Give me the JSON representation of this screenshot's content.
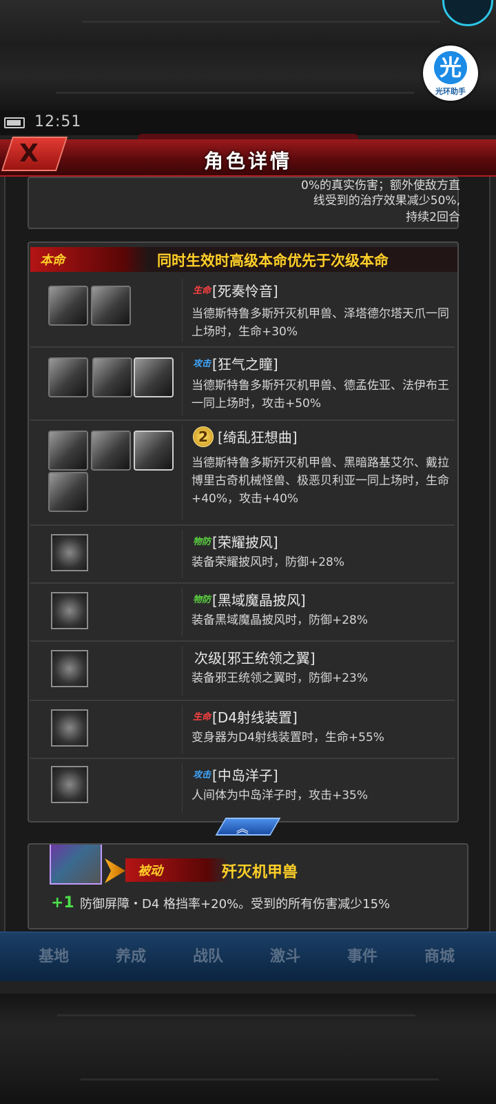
{
  "status": {
    "time": "12:51"
  },
  "helper": {
    "glyph": "光",
    "label": "光环助手"
  },
  "title": "角色详情",
  "close_label": "X",
  "prev_skill_lines": [
    "0%的真实伤害；额外使敌方直",
    "线受到的治疗效果减少50%,",
    "持续2回合"
  ],
  "benming": {
    "tag": "本命",
    "note": "同时生效时高级本命优先于次级本命",
    "rows": [
      {
        "badge": "生命",
        "name": "[死奏怜音]",
        "desc": "当德斯特鲁多斯歼灭机甲兽、泽塔德尔塔天爪一同上场时，生命+30%"
      },
      {
        "badge": "攻击",
        "name": "[狂气之瞳]",
        "desc": "当德斯特鲁多斯歼灭机甲兽、德孟佐亚、法伊布王一同上场时，攻击+50%"
      },
      {
        "badge": "2",
        "name": "[绮乱狂想曲]",
        "desc": "当德斯特鲁多斯歼灭机甲兽、黑暗路基艾尔、戴拉博里古奇机械怪兽、极恶贝利亚一同上场时，生命+40%，攻击+40%"
      },
      {
        "badge": "物防",
        "name": "[荣耀披风]",
        "desc": "装备荣耀披风时，防御+28%"
      },
      {
        "badge": "物防",
        "name": "[黑域魔晶披风]",
        "desc": "装备黑域魔晶披风时，防御+28%"
      },
      {
        "badge": "",
        "name": "次级[邪王统领之翼]",
        "desc": "装备邪王统领之翼时，防御+23%"
      },
      {
        "badge": "生命",
        "name": "[D4射线装置]",
        "desc": "变身器为D4射线装置时，生命+55%"
      },
      {
        "badge": "攻击",
        "name": "[中岛洋子]",
        "desc": "人间体为中岛洋子时，攻击+35%"
      }
    ]
  },
  "passive": {
    "tag": "被动",
    "name": "歼灭机甲兽",
    "plus": "+1",
    "desc": "防御屏障・D4 格挡率+20%。受到的所有伤害减少15%"
  },
  "nav": [
    "基地",
    "养成",
    "战队",
    "激斗",
    "事件",
    "商城"
  ],
  "colors": {
    "accent": "#ffd028",
    "title_red": "#9a1a1c",
    "life": "#ff4040",
    "attack": "#3ea8ff",
    "defense": "#5ad040"
  }
}
